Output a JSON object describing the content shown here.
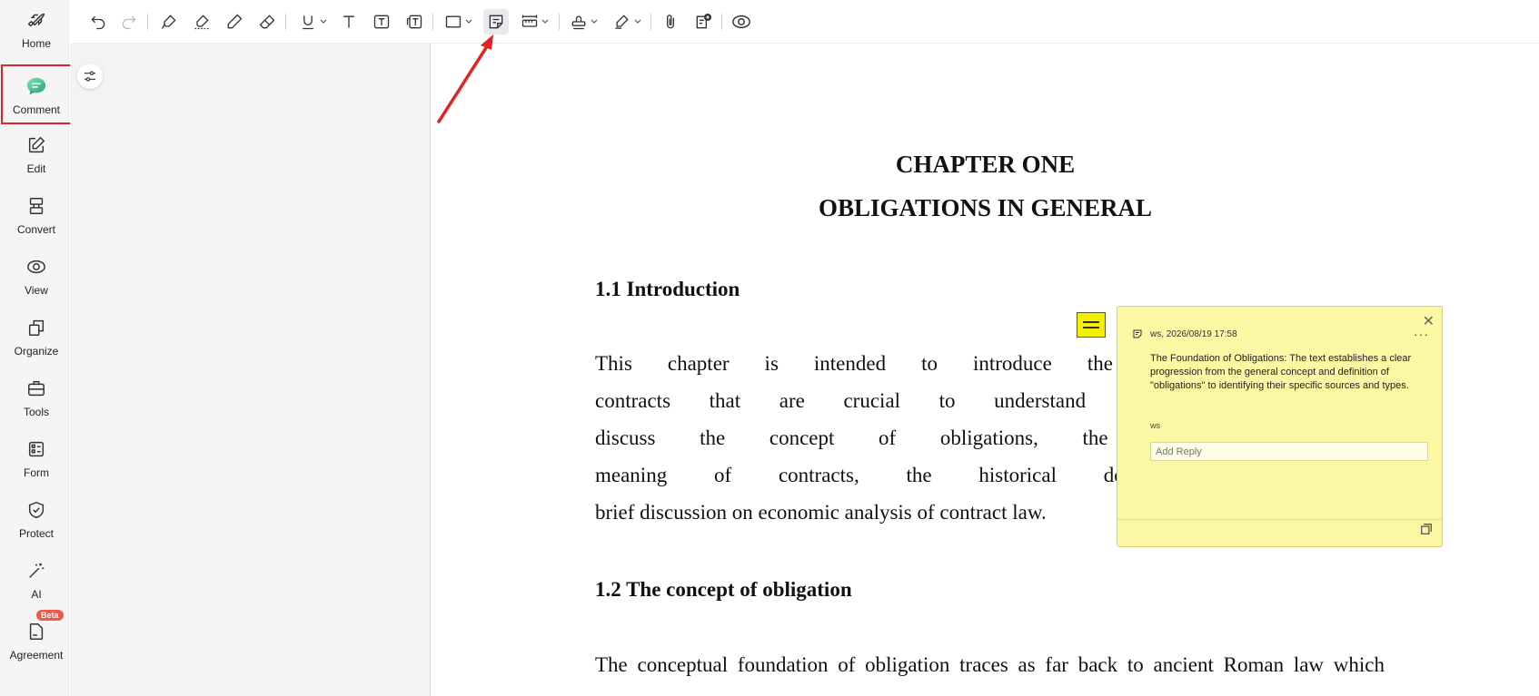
{
  "nav": {
    "items": [
      {
        "label": "Home",
        "icon": "rocket-icon"
      },
      {
        "label": "Comment",
        "icon": "comment-icon"
      },
      {
        "label": "Edit",
        "icon": "edit-icon"
      },
      {
        "label": "Convert",
        "icon": "convert-icon"
      },
      {
        "label": "View",
        "icon": "view-icon"
      },
      {
        "label": "Organize",
        "icon": "organize-icon"
      },
      {
        "label": "Tools",
        "icon": "toolbox-icon"
      },
      {
        "label": "Form",
        "icon": "form-icon"
      },
      {
        "label": "Protect",
        "icon": "shield-icon"
      },
      {
        "label": "AI",
        "icon": "magic-wand-icon"
      },
      {
        "label": "Agreement",
        "icon": "agreement-icon"
      }
    ],
    "active": "Comment",
    "beta_badge": "Beta"
  },
  "toolbar": {
    "tools": [
      "undo-icon",
      "redo-icon",
      "highlight-icon",
      "area-highlight-icon",
      "pencil-icon",
      "eraser-icon",
      "underline-icon",
      "text-icon",
      "textbox-icon",
      "callout-icon",
      "shape-icon",
      "sticky-note-icon",
      "measure-icon",
      "stamp-icon",
      "signature-icon",
      "attachment-icon",
      "add-comment-icon",
      "eye-icon"
    ],
    "highlighted": "sticky-note-icon"
  },
  "document": {
    "title1": "CHAPTER ONE",
    "title2": "OBLIGATIONS IN GENERAL",
    "h1": "1.1 Introduction",
    "para1": [
      "This chapter is intended to introduce the students to the ba",
      "contracts that are crucial to understand the chapters that fo",
      "discuss the concept of obligations, the sources of obligati",
      "meaning of contracts, the historical development of contrac",
      "brief discussion on economic analysis of contract law."
    ],
    "h2": "1.2 The concept of obligation",
    "para2": [
      "The conceptual foundation of obligation traces as far back to ancient Roman law which"
    ]
  },
  "note": {
    "author": "ws",
    "date": "2026/08/19 17:58",
    "header": "ws,  2026/08/19 17:58",
    "text": "The Foundation of Obligations: The text establishes a clear progression from the general concept and definition of \"obligations\" to identifying their specific sources and types.",
    "signature": "ws",
    "reply_placeholder": "Add Reply",
    "color": "#fbf7a3"
  },
  "colors": {
    "accent_red": "#e02424",
    "note_icon": "#f4f000"
  }
}
